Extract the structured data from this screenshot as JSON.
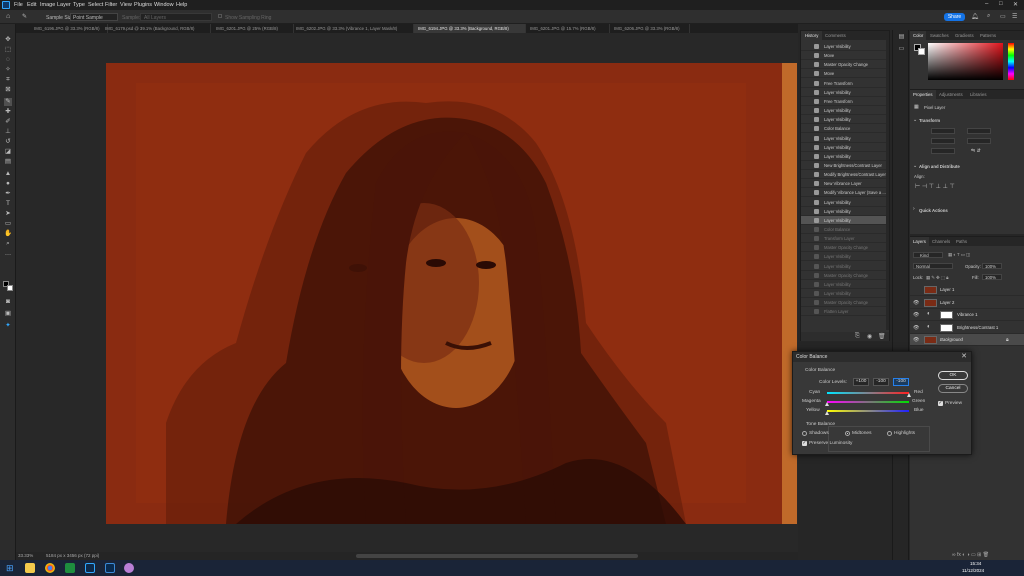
{
  "menubar": {
    "items": [
      "File",
      "Edit",
      "Image",
      "Layer",
      "Type",
      "Select",
      "Filter",
      "View",
      "Plugins",
      "Window",
      "Help"
    ],
    "window_controls": [
      "–",
      "□",
      "✕"
    ]
  },
  "options_bar": {
    "sample_size_label": "Sample Size:",
    "sample_size_value": "Point Sample",
    "sample_label": "Sample:",
    "sample_value": "All Layers",
    "sampling_ring": "Show Sampling Ring",
    "share_label": "Share"
  },
  "tabs": [
    {
      "label": "IMG_6196.JPG @ 33.3% (RGB/8)"
    },
    {
      "label": "IMG_6179.psd @ 39.1% (Background, RGB/8)"
    },
    {
      "label": "IMG_6201.JPG @ 25% (RGB/8)"
    },
    {
      "label": "IMG_6202.JPG @ 33.3% (Vibrance 1, Layer Mask/8)"
    },
    {
      "label": "IMG_6194.JPG @ 33.3% (Background, RGB/8)"
    },
    {
      "label": "IMG_6201.JPG @ 15.7% (RGB/8)"
    },
    {
      "label": "IMG_6206.JPG @ 33.3% (RGB/8)"
    }
  ],
  "status": {
    "zoom": "33.33%",
    "dimensions": "5184 px x 3456 px (72 ppi)"
  },
  "history": {
    "tabs": [
      "History",
      "Comments"
    ],
    "rows": [
      {
        "label": "Layer Visibility",
        "state": "normal"
      },
      {
        "label": "Move",
        "state": "normal"
      },
      {
        "label": "Master Opacity Change",
        "state": "normal"
      },
      {
        "label": "Move",
        "state": "normal"
      },
      {
        "label": "Free Transform",
        "state": "normal"
      },
      {
        "label": "Layer Visibility",
        "state": "normal"
      },
      {
        "label": "Free Transform",
        "state": "normal"
      },
      {
        "label": "Layer Visibility",
        "state": "normal"
      },
      {
        "label": "Layer Visibility",
        "state": "normal"
      },
      {
        "label": "Color Balance",
        "state": "normal"
      },
      {
        "label": "Layer Visibility",
        "state": "normal"
      },
      {
        "label": "Layer Visibility",
        "state": "normal"
      },
      {
        "label": "Layer Visibility",
        "state": "normal"
      },
      {
        "label": "New Brightness/Contrast Layer",
        "state": "normal"
      },
      {
        "label": "Modify Brightness/Contrast Layer",
        "state": "normal"
      },
      {
        "label": "New Vibrance Layer",
        "state": "normal"
      },
      {
        "label": "Modify Vibrance Layer (Save a ...",
        "state": "normal"
      },
      {
        "label": "Layer Visibility",
        "state": "normal"
      },
      {
        "label": "Layer Visibility",
        "state": "normal"
      },
      {
        "label": "Layer Visibility",
        "state": "selected"
      },
      {
        "label": "Color Balance",
        "state": "dim"
      },
      {
        "label": "Transform Layer",
        "state": "dim"
      },
      {
        "label": "Master Opacity Change",
        "state": "dim"
      },
      {
        "label": "Layer Visibility",
        "state": "dim"
      },
      {
        "label": "Layer Visibility",
        "state": "dim"
      },
      {
        "label": "Master Opacity Change",
        "state": "dim"
      },
      {
        "label": "Layer Visibility",
        "state": "dim"
      },
      {
        "label": "Layer Visibility",
        "state": "dim"
      },
      {
        "label": "Master Opacity Change",
        "state": "dim"
      },
      {
        "label": "Flatten Layer",
        "state": "dim"
      }
    ]
  },
  "color_panel": {
    "tabs": [
      "Color",
      "Swatches",
      "Gradients",
      "Patterns"
    ]
  },
  "properties_panel": {
    "tabs": [
      "Properties",
      "Adjustments",
      "Libraries"
    ],
    "layer_type": "Pixel Layer",
    "transform_label": "Transform",
    "align_label": "Align and Distribute",
    "align_sub": "Align:",
    "quick_actions": "Quick Actions"
  },
  "layers_panel": {
    "tabs": [
      "Layers",
      "Channels",
      "Paths"
    ],
    "kind": "Kind",
    "blend_mode": "Normal",
    "opacity_label": "Opacity:",
    "opacity": "100%",
    "lock_label": "Lock:",
    "fill_label": "Fill:",
    "fill": "100%",
    "layers": [
      {
        "name": "Layer 1",
        "visible": false,
        "kind": "pixel"
      },
      {
        "name": "Layer 2",
        "visible": true,
        "kind": "pixel"
      },
      {
        "name": "Vibrance 1",
        "visible": true,
        "kind": "adjustment"
      },
      {
        "name": "Brightness/Contrast 1",
        "visible": true,
        "kind": "adjustment"
      },
      {
        "name": "Background",
        "visible": true,
        "kind": "pixel",
        "selected": true
      }
    ]
  },
  "color_balance_dialog": {
    "title": "Color Balance",
    "section_title": "Color Balance",
    "color_levels_label": "Color Levels:",
    "levels": [
      "+100",
      "-100",
      "-100"
    ],
    "sliders": [
      {
        "left": "Cyan",
        "right": "Red",
        "value": 100
      },
      {
        "left": "Magenta",
        "right": "Green",
        "value": -100
      },
      {
        "left": "Yellow",
        "right": "Blue",
        "value": -100
      }
    ],
    "tone_title": "Tone Balance",
    "tones": [
      "Shadows",
      "Midtones",
      "Highlights"
    ],
    "selected_tone": "Midtones",
    "preserve_luminosity": "Preserve Luminosity",
    "ok": "OK",
    "cancel": "Cancel",
    "preview": "Preview"
  },
  "taskbar": {
    "time": "15:34",
    "date": "11/12/2024"
  }
}
